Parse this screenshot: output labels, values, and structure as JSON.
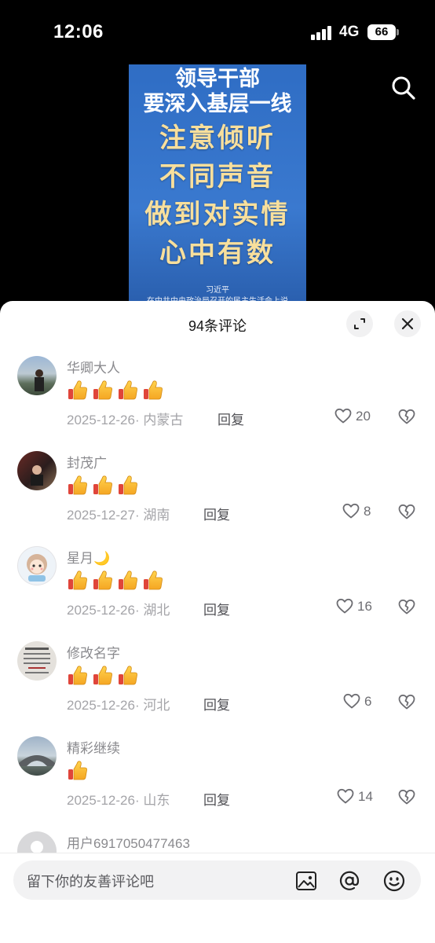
{
  "status_bar": {
    "time": "12:06",
    "network": "4G",
    "battery": "66"
  },
  "poster": {
    "lines_white": [
      "领导干部",
      "要深入基层一线"
    ],
    "lines_yellow": [
      "注意倾听",
      "不同声音",
      "做到对实情",
      "心中有数"
    ],
    "author": "习近平",
    "source": "在中共中央政治局召开的民主生活会上说"
  },
  "comments_header": {
    "title": "94条评论"
  },
  "comments": [
    {
      "user": "华卿大人",
      "thumbs": 4,
      "date": "2025-12-26",
      "region": "内蒙古",
      "reply": "回复",
      "likes": "20"
    },
    {
      "user": "封茂广",
      "thumbs": 3,
      "date": "2025-12-27",
      "region": "湖南",
      "reply": "回复",
      "likes": "8"
    },
    {
      "user": "星月🌙",
      "thumbs": 4,
      "date": "2025-12-26",
      "region": "湖北",
      "reply": "回复",
      "likes": "16"
    },
    {
      "user": "修改名字",
      "thumbs": 3,
      "date": "2025-12-26",
      "region": "河北",
      "reply": "回复",
      "likes": "6"
    },
    {
      "user": "精彩继续",
      "thumbs": 1,
      "date": "2025-12-26",
      "region": "山东",
      "reply": "回复",
      "likes": "14"
    },
    {
      "user": "用户6917050477463"
    }
  ],
  "input": {
    "placeholder": "留下你的友善评论吧"
  },
  "icons": [
    "search-icon",
    "expand-icon",
    "close-icon",
    "heart-icon",
    "dislike-icon",
    "image-icon",
    "at-icon",
    "emoji-icon"
  ]
}
